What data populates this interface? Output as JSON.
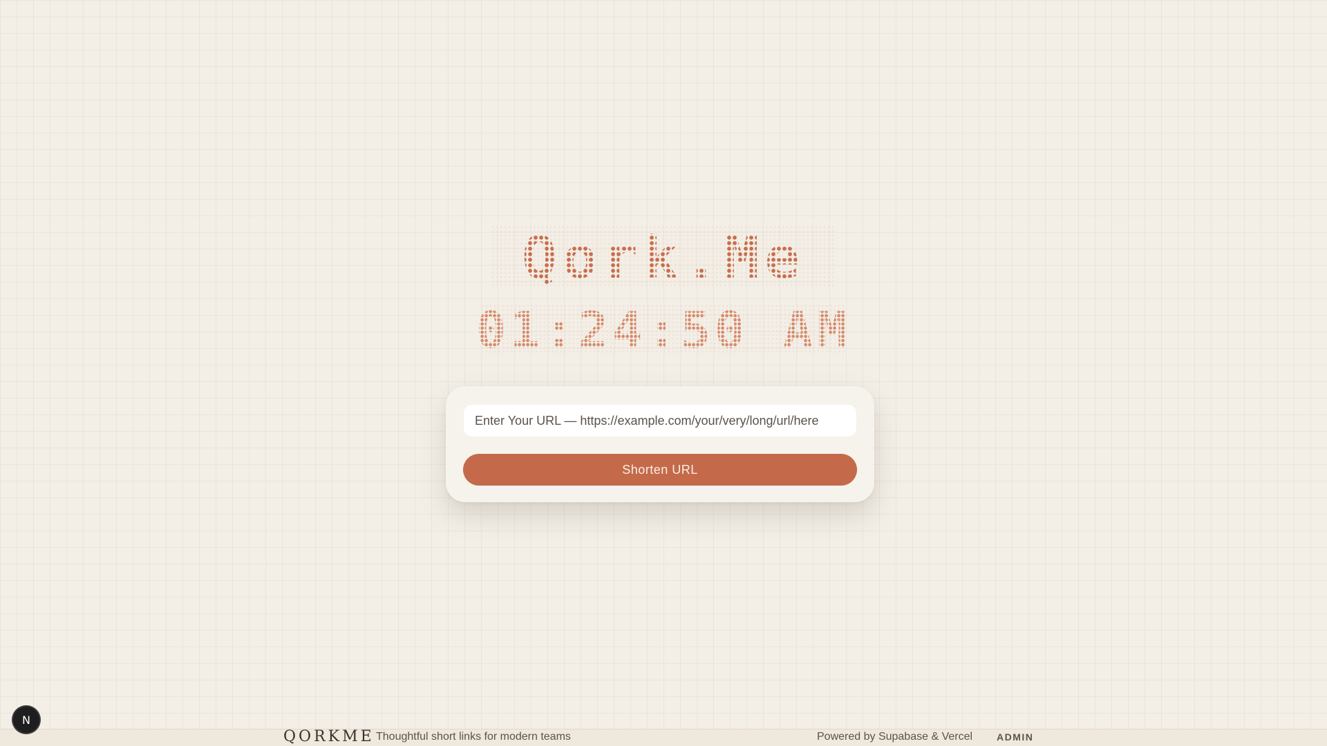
{
  "brand": {
    "logo_text": "Qork.Me"
  },
  "clock": {
    "time": "01:24:50 AM"
  },
  "shortener": {
    "input_placeholder": "Enter Your URL — https://example.com/your/very/long/url/here",
    "input_value": "",
    "button_label": "Shorten URL"
  },
  "footer": {
    "brand": "QORKME",
    "tagline": "Thoughtful short links for modern teams",
    "powered_by": "Powered by Supabase & Vercel",
    "admin_link": "ADMIN"
  },
  "devtools": {
    "badge_letter": "N"
  },
  "colors": {
    "background": "#f3efe7",
    "accent": "#c46a4a",
    "dot_matrix": "#cf8463",
    "card": "#f6f2ec"
  }
}
